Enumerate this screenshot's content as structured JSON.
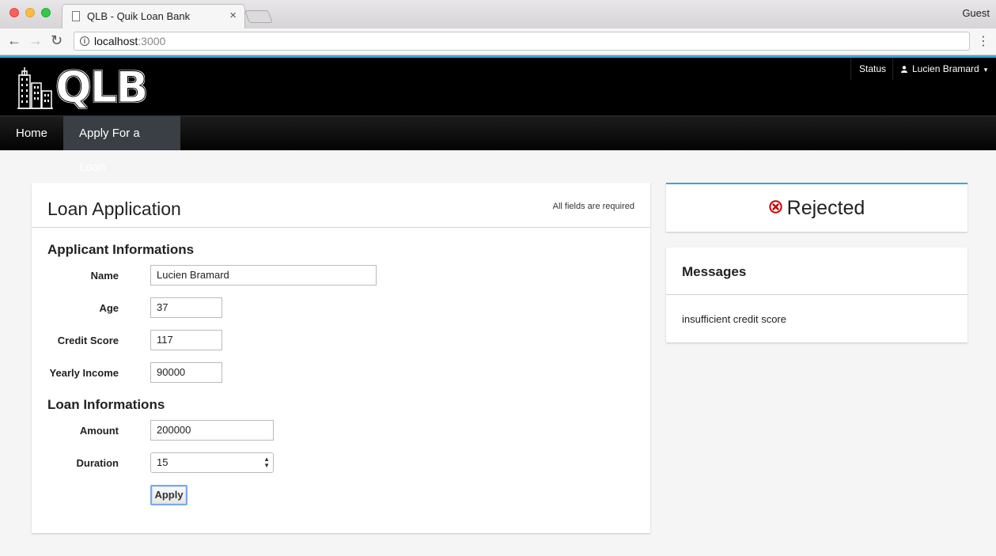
{
  "browser": {
    "tab_title": "QLB - Quik Loan Bank",
    "tab_close": "×",
    "profile": "Guest",
    "url_host": "localhost",
    "url_port": ":3000",
    "back": "←",
    "forward": "→",
    "reload": "↻",
    "menu": "⋮"
  },
  "header": {
    "logo_text": "QLB",
    "status_link": "Status",
    "user_name": "Lucien Bramard",
    "caret": "▾",
    "accent_color": "#39a5dc"
  },
  "nav": {
    "items": [
      {
        "label": "Home",
        "active": false
      },
      {
        "label": "Apply For a Loan",
        "active": true
      }
    ]
  },
  "loan_form": {
    "title": "Loan Application",
    "note": "All fields are required",
    "applicant_section": "Applicant Informations",
    "loan_section": "Loan Informations",
    "fields": {
      "name": {
        "label": "Name",
        "value": "Lucien Bramard"
      },
      "age": {
        "label": "Age",
        "value": "37"
      },
      "credit_score": {
        "label": "Credit Score",
        "value": "117"
      },
      "yearly_income": {
        "label": "Yearly Income",
        "value": "90000"
      },
      "amount": {
        "label": "Amount",
        "value": "200000"
      },
      "duration": {
        "label": "Duration",
        "value": "15"
      }
    },
    "apply_label": "Apply"
  },
  "status": {
    "text": "Rejected",
    "icon": "error-circle-icon",
    "icon_color": "#cc0000"
  },
  "messages": {
    "title": "Messages",
    "items": [
      "insufficient credit score"
    ]
  }
}
